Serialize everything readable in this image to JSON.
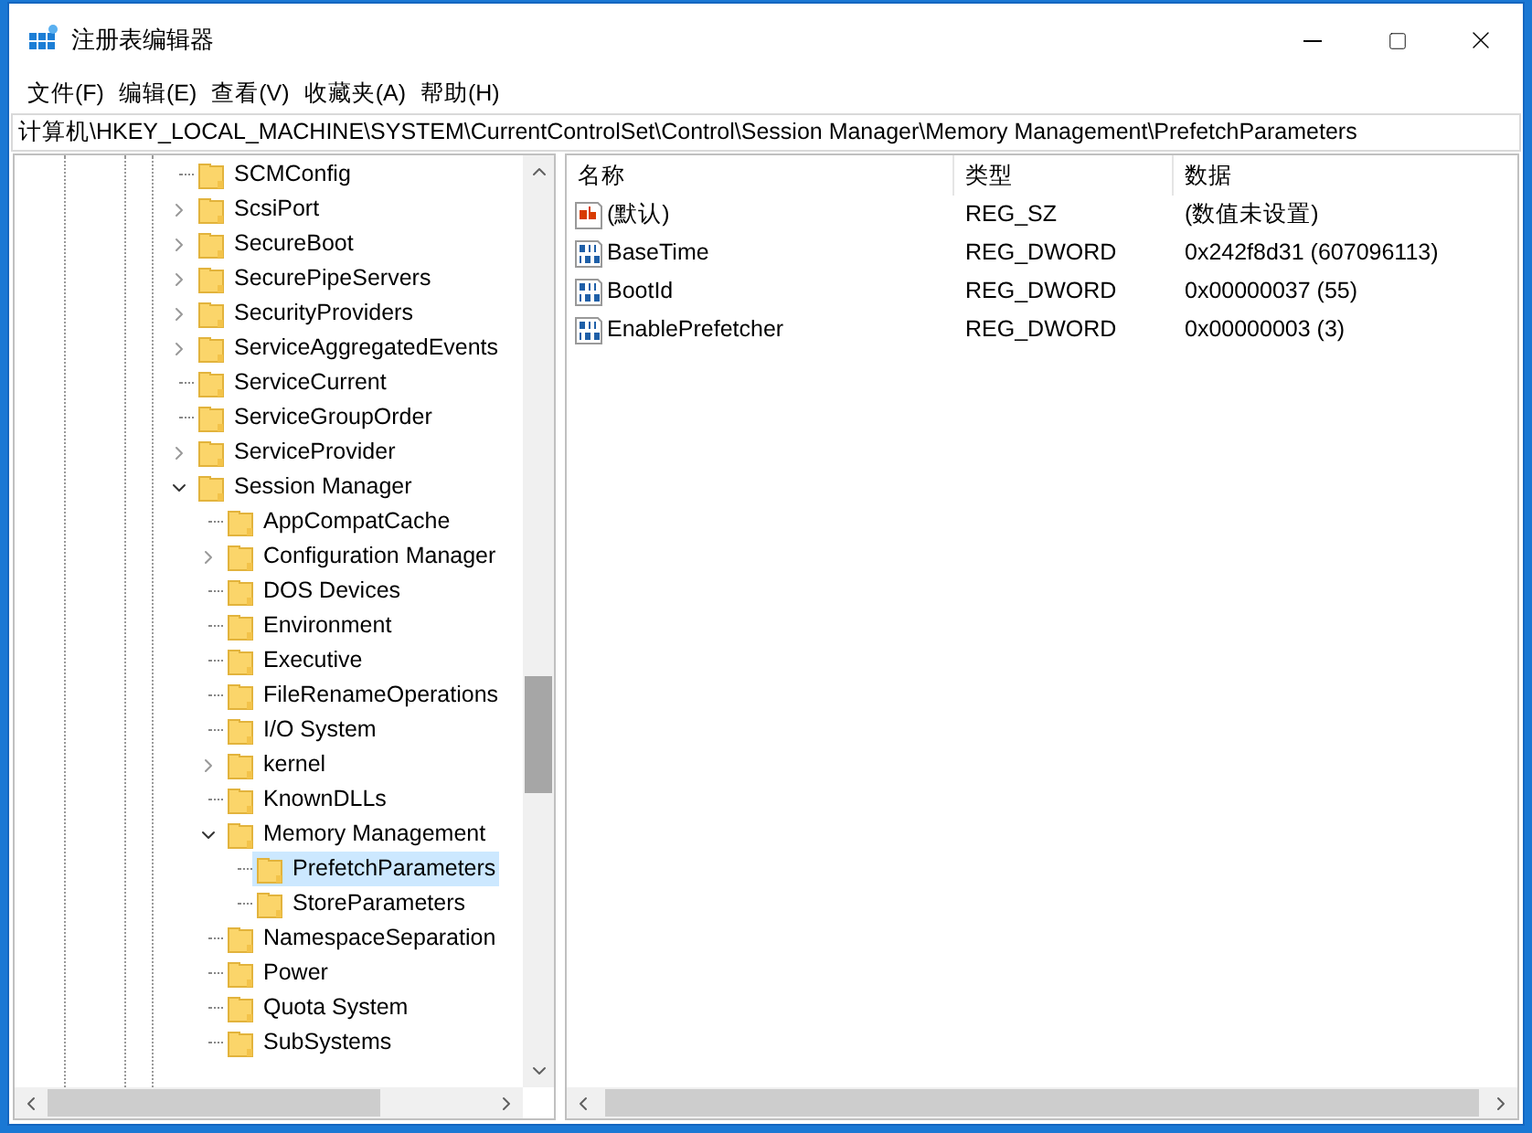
{
  "window": {
    "title": "注册表编辑器"
  },
  "menu": [
    "文件(F)",
    "编辑(E)",
    "查看(V)",
    "收藏夹(A)",
    "帮助(H)"
  ],
  "address": "计算机\\HKEY_LOCAL_MACHINE\\SYSTEM\\CurrentControlSet\\Control\\Session Manager\\Memory Management\\PrefetchParameters",
  "tree": [
    {
      "label": "SCMConfig",
      "has_children": false,
      "selected": false
    },
    {
      "label": "ScsiPort",
      "has_children": true,
      "expanded": false,
      "selected": false
    },
    {
      "label": "SecureBoot",
      "has_children": true,
      "expanded": false,
      "selected": false
    },
    {
      "label": "SecurePipeServers",
      "has_children": true,
      "expanded": false,
      "selected": false
    },
    {
      "label": "SecurityProviders",
      "has_children": true,
      "expanded": false,
      "selected": false
    },
    {
      "label": "ServiceAggregatedEvents",
      "has_children": true,
      "expanded": false,
      "selected": false
    },
    {
      "label": "ServiceCurrent",
      "has_children": false,
      "selected": false
    },
    {
      "label": "ServiceGroupOrder",
      "has_children": false,
      "selected": false
    },
    {
      "label": "ServiceProvider",
      "has_children": true,
      "expanded": false,
      "selected": false
    },
    {
      "label": "Session Manager",
      "has_children": true,
      "expanded": true,
      "selected": false,
      "children": [
        {
          "label": "AppCompatCache",
          "has_children": false,
          "selected": false
        },
        {
          "label": "Configuration Manager",
          "has_children": true,
          "expanded": false,
          "selected": false
        },
        {
          "label": "DOS Devices",
          "has_children": false,
          "selected": false
        },
        {
          "label": "Environment",
          "has_children": false,
          "selected": false
        },
        {
          "label": "Executive",
          "has_children": false,
          "selected": false
        },
        {
          "label": "FileRenameOperations",
          "has_children": false,
          "selected": false
        },
        {
          "label": "I/O System",
          "has_children": false,
          "selected": false
        },
        {
          "label": "kernel",
          "has_children": true,
          "expanded": false,
          "selected": false
        },
        {
          "label": "KnownDLLs",
          "has_children": false,
          "selected": false
        },
        {
          "label": "Memory Management",
          "has_children": true,
          "expanded": true,
          "selected": false,
          "children": [
            {
              "label": "PrefetchParameters",
              "has_children": false,
              "selected": true
            },
            {
              "label": "StoreParameters",
              "has_children": false,
              "selected": false
            }
          ]
        },
        {
          "label": "NamespaceSeparation",
          "has_children": false,
          "selected": false
        },
        {
          "label": "Power",
          "has_children": false,
          "selected": false
        },
        {
          "label": "Quota System",
          "has_children": false,
          "selected": false
        },
        {
          "label": "SubSystems",
          "has_children": false,
          "selected": false
        }
      ]
    }
  ],
  "table": {
    "columns": [
      "名称",
      "类型",
      "数据"
    ],
    "rows": [
      {
        "kind": "string",
        "name": "(默认)",
        "type": "REG_SZ",
        "data": "(数值未设置)"
      },
      {
        "kind": "dword",
        "name": "BaseTime",
        "type": "REG_DWORD",
        "data": "0x242f8d31 (607096113)"
      },
      {
        "kind": "dword",
        "name": "BootId",
        "type": "REG_DWORD",
        "data": "0x00000037 (55)"
      },
      {
        "kind": "dword",
        "name": "EnablePrefetcher",
        "type": "REG_DWORD",
        "data": "0x00000003 (3)"
      }
    ]
  }
}
